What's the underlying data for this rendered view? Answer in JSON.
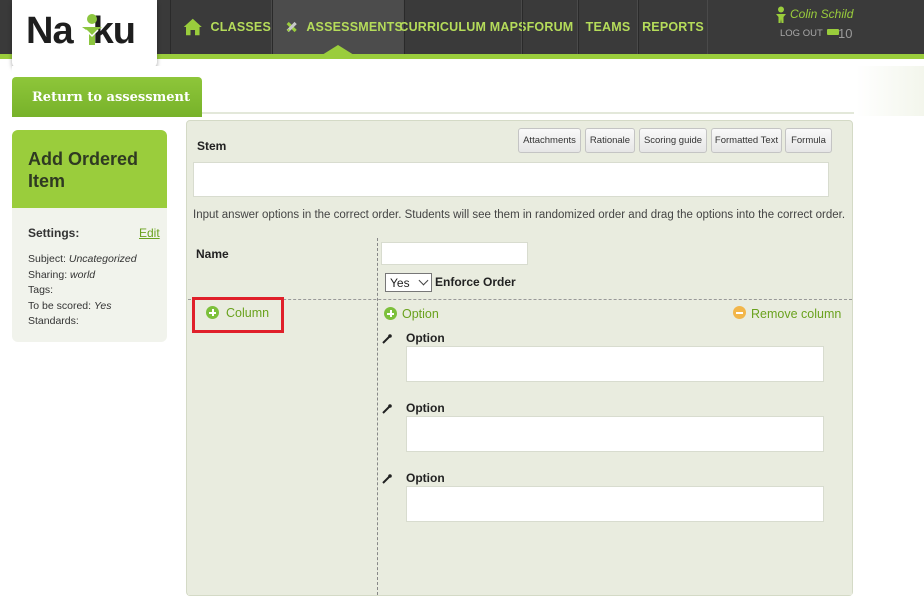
{
  "header": {
    "logo_text": "Naiku",
    "nav": [
      {
        "label": "CLASSES",
        "icon": "home-icon"
      },
      {
        "label": "ASSESSMENTS",
        "icon": "pencil-ruler-icon",
        "active": true
      },
      {
        "label": "CURRICULUM MAPS"
      },
      {
        "label": "FORUM"
      },
      {
        "label": "TEAMS"
      },
      {
        "label": "REPORTS"
      }
    ],
    "user_name": "Colin Schild",
    "logout_label": "LOG OUT",
    "points": "10"
  },
  "return_label": "Return to assessment",
  "sidebar": {
    "title": "Add Ordered Item",
    "settings_label": "Settings:",
    "edit_label": "Edit",
    "meta": {
      "subject_label": "Subject:",
      "subject_value": "Uncategorized",
      "sharing_label": "Sharing:",
      "sharing_value": "world",
      "tags_label": "Tags:",
      "scored_label": "To be scored:",
      "scored_value": "Yes",
      "standards_label": "Standards:"
    }
  },
  "editor": {
    "stem_label": "Stem",
    "toolbar": [
      "Attachments",
      "Rationale",
      "Scoring guide",
      "Formatted Text",
      "Formula"
    ],
    "stem_value": "",
    "instructions": "Input answer options in the correct order. Students will see them in randomized order and drag the options into the correct order.",
    "name_label": "Name",
    "name_value": "",
    "enforce_select_value": "Yes",
    "enforce_label": "Enforce Order",
    "column_label": "Column",
    "add_option_label": "Option",
    "remove_column_label": "Remove column",
    "options": [
      {
        "label": "Option",
        "value": ""
      },
      {
        "label": "Option",
        "value": ""
      },
      {
        "label": "Option",
        "value": ""
      }
    ]
  },
  "colors": {
    "accent": "#9acd3c",
    "link": "#6aa21e",
    "topbar": "#3a3a3a",
    "highlight": "#e0202a",
    "remove": "#f2b64a"
  }
}
